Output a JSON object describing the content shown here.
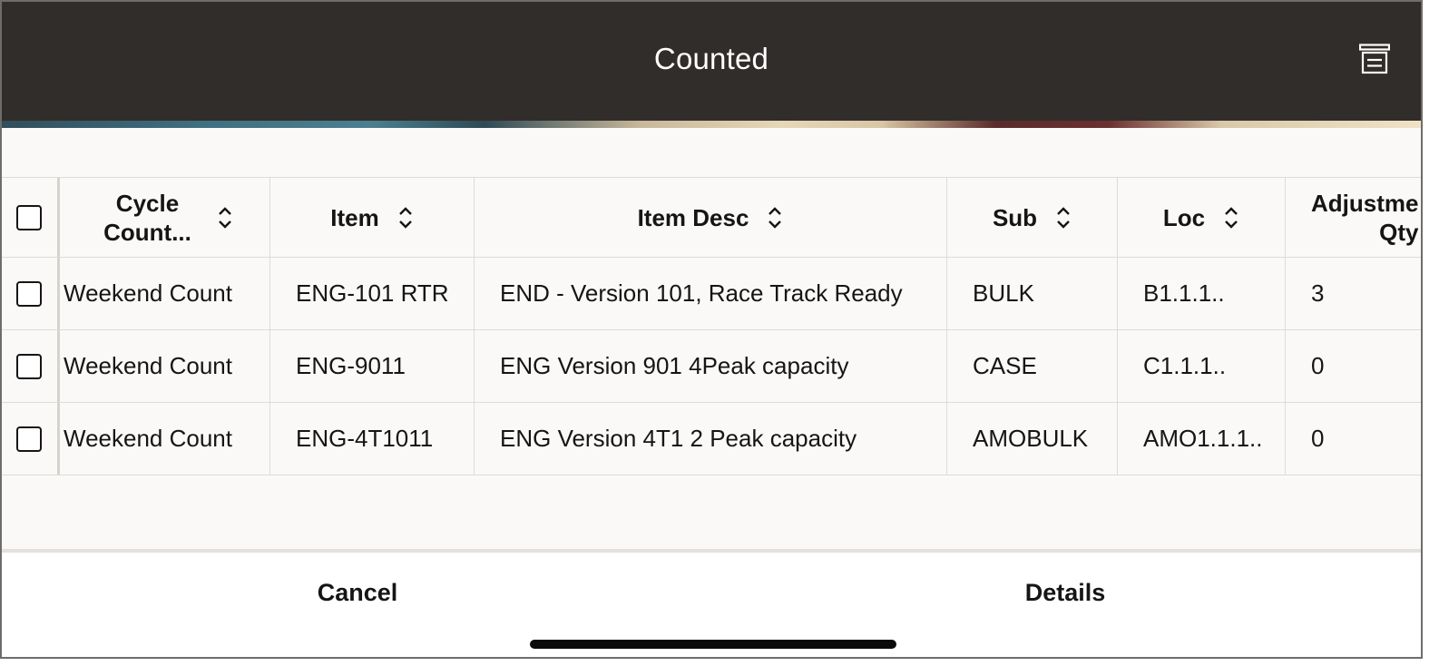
{
  "header": {
    "title": "Counted",
    "icon": "filter-list-icon"
  },
  "colors": {
    "header_bg": "#312d2a",
    "content_bg": "#fbf9f8",
    "divider": "#dedbd7",
    "text": "#161513"
  },
  "table": {
    "columns": [
      {
        "key": "cycle_count",
        "label_line1": "Cycle",
        "label_line2": "Count...",
        "sortable": true
      },
      {
        "key": "item",
        "label": "Item",
        "sortable": true
      },
      {
        "key": "item_desc",
        "label": "Item Desc",
        "sortable": true
      },
      {
        "key": "sub",
        "label": "Sub",
        "sortable": true
      },
      {
        "key": "loc",
        "label": "Loc",
        "sortable": true
      },
      {
        "key": "adjustment_qty",
        "label_line1": "Adjustme",
        "label_line2": "Qty",
        "sortable": false
      }
    ],
    "rows": [
      {
        "checked": false,
        "cycle_count": "Weekend Count",
        "item": "ENG-101 RTR",
        "item_desc": "END - Version 101, Race Track Ready",
        "sub": "BULK",
        "loc": "B1.1.1..",
        "adjustment_qty": "3"
      },
      {
        "checked": false,
        "cycle_count": "Weekend Count",
        "item": "ENG-9011",
        "item_desc": "ENG Version 901 4Peak capacity",
        "sub": "CASE",
        "loc": "C1.1.1..",
        "adjustment_qty": "0"
      },
      {
        "checked": false,
        "cycle_count": "Weekend Count",
        "item": "ENG-4T1011",
        "item_desc": "ENG Version 4T1 2 Peak capacity",
        "sub": "AMOBULK",
        "loc": "AMO1.1.1..",
        "adjustment_qty": "0"
      }
    ]
  },
  "footer": {
    "cancel_label": "Cancel",
    "details_label": "Details"
  }
}
